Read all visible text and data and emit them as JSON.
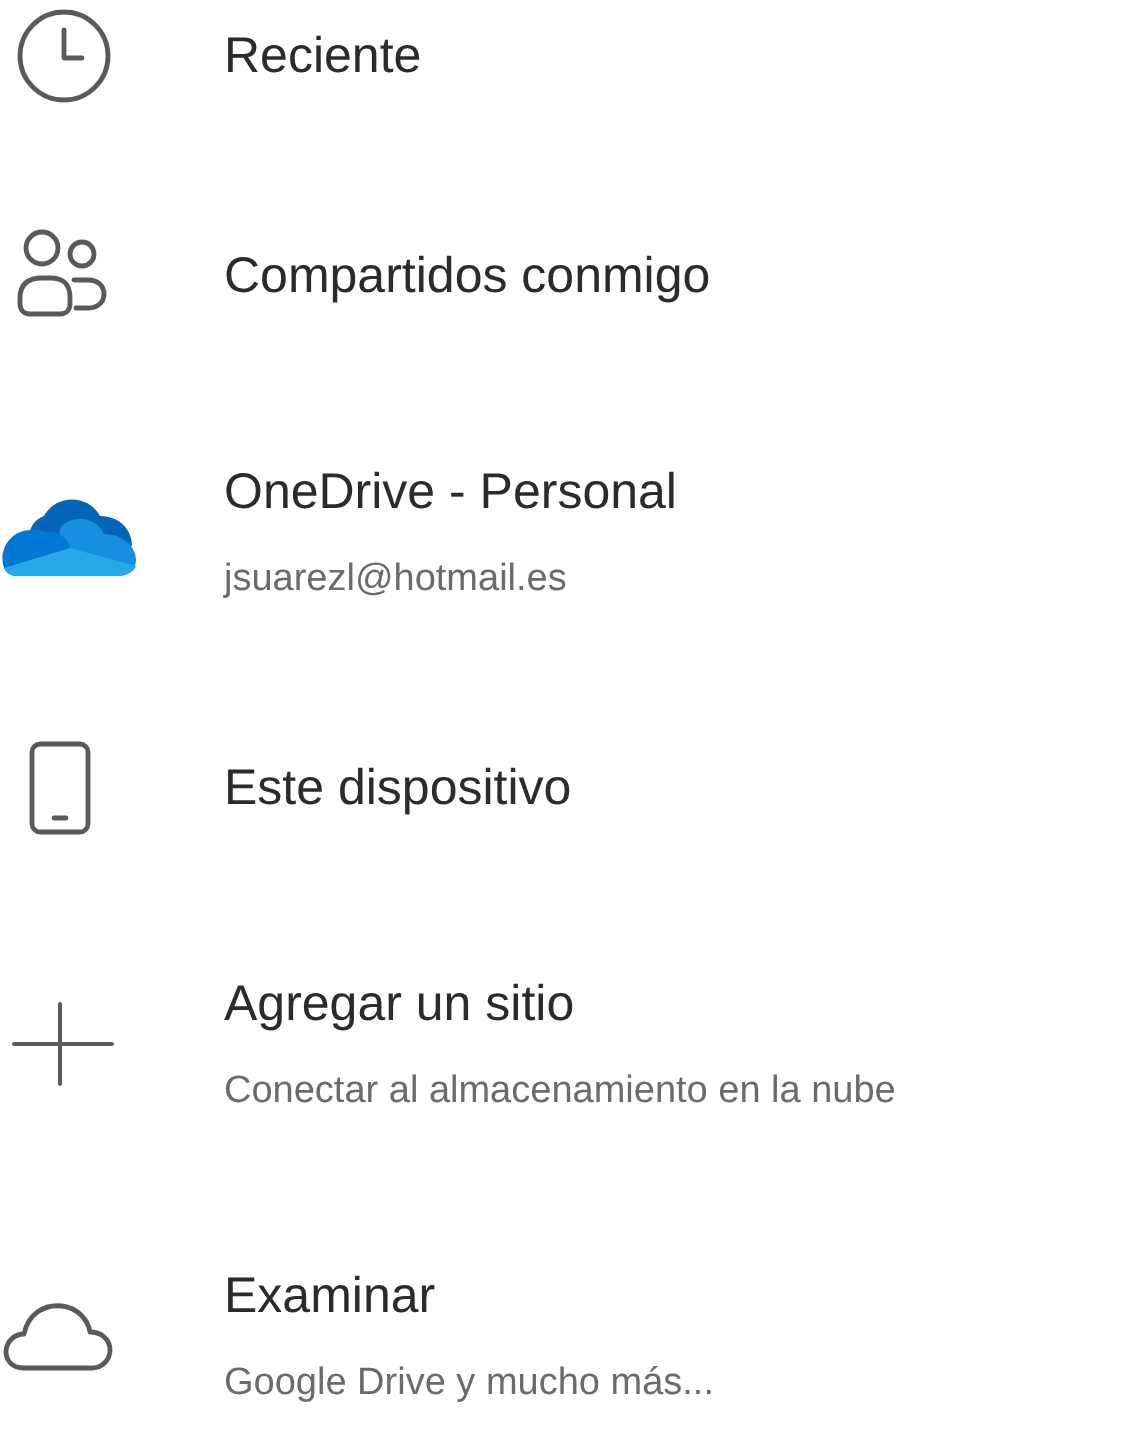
{
  "items": [
    {
      "kind": "clock",
      "title": "Reciente"
    },
    {
      "kind": "people",
      "title": "Compartidos conmigo"
    },
    {
      "kind": "onedrive",
      "title": "OneDrive - Personal",
      "subtitle": "jsuarezl@hotmail.es"
    },
    {
      "kind": "phone",
      "title": "Este dispositivo"
    },
    {
      "kind": "plus",
      "title": "Agregar un sitio",
      "subtitle": "Conectar al almacenamiento en la nube"
    },
    {
      "kind": "cloud",
      "title": "Examinar",
      "subtitle": "Google Drive y mucho más..."
    }
  ]
}
